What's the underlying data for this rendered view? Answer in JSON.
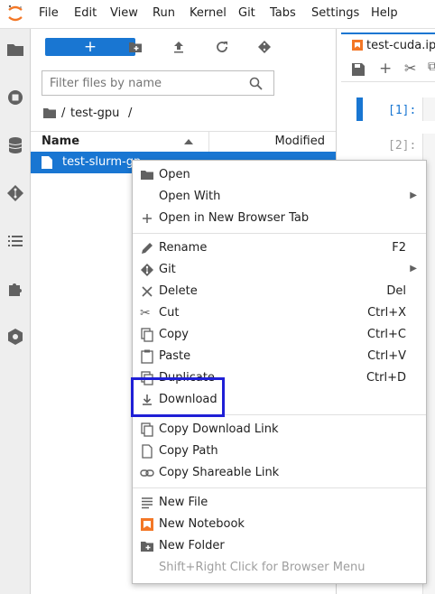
{
  "menubar": {
    "items": [
      "File",
      "Edit",
      "View",
      "Run",
      "Kernel",
      "Git",
      "Tabs",
      "Settings",
      "Help"
    ]
  },
  "toolbar": {
    "new_label": "+"
  },
  "filter": {
    "placeholder": "Filter files by name"
  },
  "breadcrumb": {
    "separator1": "/",
    "folder": "test-gpu",
    "separator2": "/"
  },
  "columns": {
    "name": "Name",
    "modified": "Modified"
  },
  "selected_file": {
    "name": "test-slurm-gp"
  },
  "right": {
    "tab": "test-cuda.ipy",
    "prompt1": "[1]:",
    "prompt2": "[2]:"
  },
  "context_menu": {
    "items": [
      {
        "label": "Open",
        "shortcut": ""
      },
      {
        "label": "Open With",
        "shortcut": ""
      },
      {
        "label": "Open in New Browser Tab",
        "shortcut": ""
      },
      {
        "label": "Rename",
        "shortcut": "F2"
      },
      {
        "label": "Git",
        "shortcut": ""
      },
      {
        "label": "Delete",
        "shortcut": "Del"
      },
      {
        "label": "Cut",
        "shortcut": "Ctrl+X"
      },
      {
        "label": "Copy",
        "shortcut": "Ctrl+C"
      },
      {
        "label": "Paste",
        "shortcut": "Ctrl+V"
      },
      {
        "label": "Duplicate",
        "shortcut": "Ctrl+D"
      },
      {
        "label": "Download",
        "shortcut": ""
      },
      {
        "label": "Copy Download Link",
        "shortcut": ""
      },
      {
        "label": "Copy Path",
        "shortcut": ""
      },
      {
        "label": "Copy Shareable Link",
        "shortcut": ""
      },
      {
        "label": "New File",
        "shortcut": ""
      },
      {
        "label": "New Notebook",
        "shortcut": ""
      },
      {
        "label": "New Folder",
        "shortcut": ""
      },
      {
        "label": "Shift+Right Click for Browser Menu",
        "shortcut": ""
      }
    ]
  },
  "colors": {
    "accent": "#1976d2",
    "highlight_box": "#1f1fd6",
    "jupyter_orange": "#f37726"
  }
}
